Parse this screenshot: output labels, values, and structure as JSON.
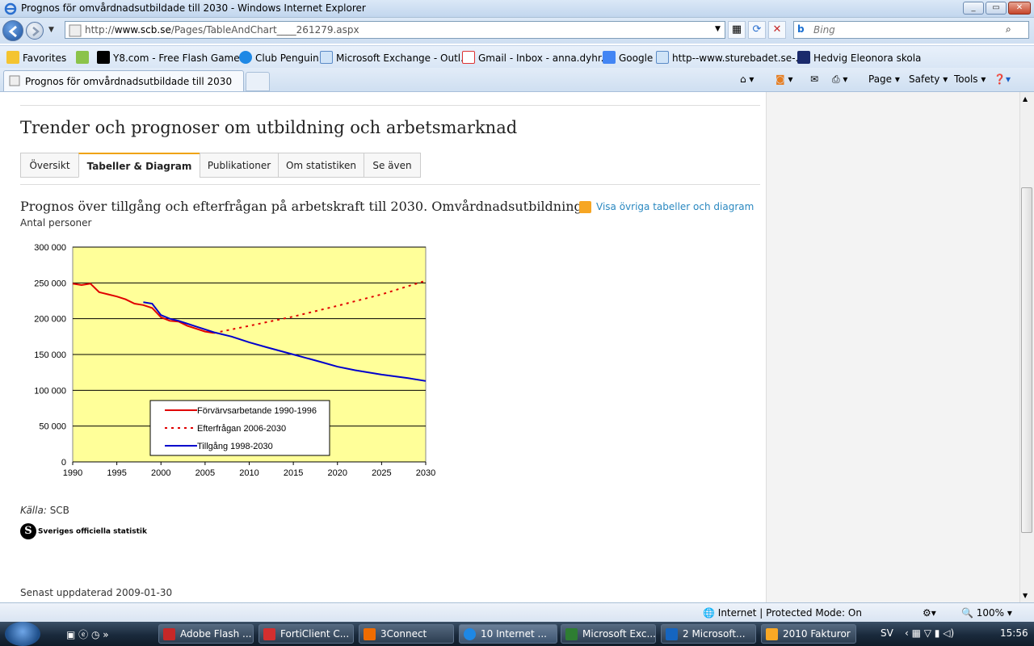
{
  "window": {
    "title": "Prognos för omvårdnadsutbildade till 2030 - Windows Internet Explorer",
    "url_prefix": "http://",
    "url_domain": "www.scb.se",
    "url_path": "/Pages/TableAndChart____261279.aspx",
    "search_placeholder": "Bing"
  },
  "favorites": {
    "label": "Favorites",
    "items": [
      "Y8.com - Free Flash Game...",
      "Club Penguin",
      "Microsoft Exchange - Outl...",
      "Gmail - Inbox - anna.dyhr...",
      "Google",
      "http--www.sturebadet.se-...",
      "Hedvig Eleonora skola"
    ]
  },
  "tabs": {
    "active_tab": "Prognos för omvårdnadsutbildade till 2030"
  },
  "commandbar": {
    "page": "Page",
    "safety": "Safety",
    "tools": "Tools"
  },
  "page": {
    "title": "Trender och prognoser om utbildning och arbetsmarknad",
    "tabs": [
      "Översikt",
      "Tabeller & Diagram",
      "Publikationer",
      "Om statistiken",
      "Se även"
    ],
    "active_tab_index": 1,
    "chart_heading": "Prognos över tillgång och efterfrågan på arbetskraft till 2030. Omvårdnadsutbildning",
    "chart_subheading": "Antal personer",
    "other_link": "Visa övriga tabeller och diagram",
    "source_label": "Källa:",
    "source_value": "SCB",
    "sos_label": "Sveriges officiella statistik",
    "updated": "Senast uppdaterad 2009-01-30"
  },
  "chart_data": {
    "type": "line",
    "title": "",
    "xlabel": "",
    "ylabel": "",
    "xlim": [
      1990,
      2030
    ],
    "ylim": [
      0,
      300000
    ],
    "xticks": [
      "1990",
      "1995",
      "2000",
      "2005",
      "2010",
      "2015",
      "2020",
      "2025",
      "2030"
    ],
    "yticks": [
      "0",
      "50 000",
      "100 000",
      "150 000",
      "200 000",
      "250 000",
      "300 000"
    ],
    "grid": true,
    "legend_position": "bottom-center",
    "background_color": "#ffff99",
    "series": [
      {
        "name": "Förvärvsarbetande 1990-1996",
        "color": "#e00000",
        "style": "solid",
        "x": [
          1990,
          1991,
          1992,
          1993,
          1994,
          1995,
          1996,
          1997,
          1998,
          1999,
          2000,
          2001,
          2002,
          2003,
          2004,
          2005,
          2006
        ],
        "y": [
          249000,
          247000,
          249000,
          237000,
          234000,
          231000,
          227000,
          221000,
          219000,
          215000,
          202000,
          197000,
          196000,
          190000,
          186000,
          182000,
          180000
        ]
      },
      {
        "name": "Efterfrågan 2006-2030",
        "color": "#e00000",
        "style": "dotted",
        "x": [
          2006,
          2010,
          2015,
          2020,
          2025,
          2030
        ],
        "y": [
          180000,
          190000,
          203000,
          218000,
          234000,
          253000
        ]
      },
      {
        "name": "Tillgång 1998-2030",
        "color": "#0000cc",
        "style": "solid",
        "x": [
          1998,
          1999,
          2000,
          2001,
          2002,
          2003,
          2004,
          2005,
          2006,
          2008,
          2010,
          2012,
          2015,
          2018,
          2020,
          2022,
          2025,
          2028,
          2030
        ],
        "y": [
          223000,
          221000,
          205000,
          200000,
          197000,
          193000,
          189000,
          185000,
          181000,
          175000,
          167000,
          160000,
          150000,
          140000,
          133000,
          128000,
          122000,
          117000,
          113000
        ]
      }
    ]
  },
  "status": {
    "zone": "Internet | Protected Mode: On",
    "zoom": "100%"
  },
  "taskbar": {
    "items": [
      "Adobe Flash ...",
      "FortiClient C...",
      "3Connect",
      "10 Internet ...",
      "Microsoft Exc...",
      "2 Microsoft...",
      "2010 Fakturor"
    ],
    "language": "SV",
    "time": "15:56"
  }
}
